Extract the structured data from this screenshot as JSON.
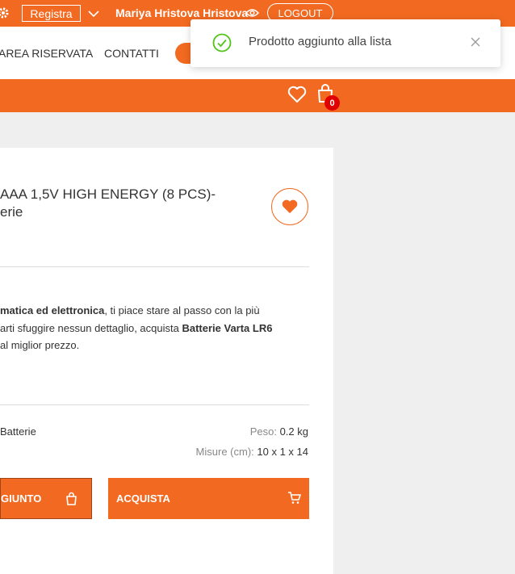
{
  "topbar": {
    "register_label": "Registra",
    "user_name": "Mariya Hristova Hristova",
    "logout_label": "LOGOUT"
  },
  "nav": {
    "items": [
      "AREA RISERVATA",
      "CONTATTI"
    ]
  },
  "cart": {
    "count": "0"
  },
  "toast": {
    "message": "Prodotto aggiunto alla lista"
  },
  "product": {
    "title_line1": "AAA 1,5V HIGH ENERGY (8 PCS)-",
    "title_line2": "erie",
    "desc_part1": "matica ed elettronica",
    "desc_part2": ", ti piace stare al passo con la più",
    "desc_part3": "arti sfuggire nessun dettaglio, acquista ",
    "desc_part4": "Batterie Varta LR6",
    "desc_part5": "al miglior prezzo.",
    "category": "Batterie",
    "weight_label": "Peso:",
    "weight_value": "0.2 kg",
    "size_label": "Misure (cm):",
    "size_value": "10 x 1 x 14",
    "added_label": "GIUNTO",
    "buy_label": "ACQUISTA"
  },
  "colors": {
    "accent": "#f26a21",
    "badge": "#e00000",
    "success": "#52c41a"
  },
  "icons": [
    "gear-icon",
    "chevron-down-icon",
    "eye-icon",
    "heart-icon",
    "shopping-bag-icon",
    "check-circle-icon",
    "close-icon",
    "cart-icon"
  ]
}
